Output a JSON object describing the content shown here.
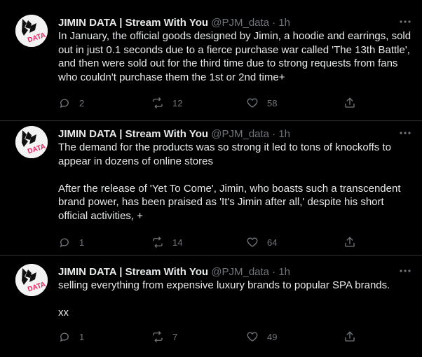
{
  "tweets": [
    {
      "author_name": "JIMIN DATA | Stream With You",
      "handle_time": "@PJM_data · 1h",
      "text": "In January, the official goods designed by Jimin, a hoodie and earrings, sold out in just 0.1 seconds due to a fierce purchase war called 'The 13th Battle', and then were sold out for the third time due to strong requests from fans who couldn't purchase them the 1st or 2nd time+",
      "replies": "2",
      "retweets": "12",
      "likes": "58"
    },
    {
      "author_name": "JIMIN DATA | Stream With You",
      "handle_time": "@PJM_data · 1h",
      "text": "The demand for the products was so strong it led to tons of knockoffs to appear in dozens of online stores\n\nAfter the release of 'Yet To Come', Jimin, who boasts such a transcendent brand power, has been praised as 'It's Jimin after all,' despite his short official activities, +",
      "replies": "1",
      "retweets": "14",
      "likes": "64"
    },
    {
      "author_name": "JIMIN DATA | Stream With You",
      "handle_time": "@PJM_data · 1h",
      "text": "selling everything from expensive luxury brands to popular SPA brands.\n\nxx",
      "replies": "1",
      "retweets": "7",
      "likes": "49"
    }
  ],
  "avatar_logo_text": "DATA",
  "colors": {
    "background": "#000000",
    "text": "#e7e9ea",
    "muted": "#71767b",
    "logo_red": "#e0245e"
  },
  "icons": [
    "reply-icon",
    "retweet-icon",
    "like-icon",
    "share-icon",
    "more-icon"
  ]
}
